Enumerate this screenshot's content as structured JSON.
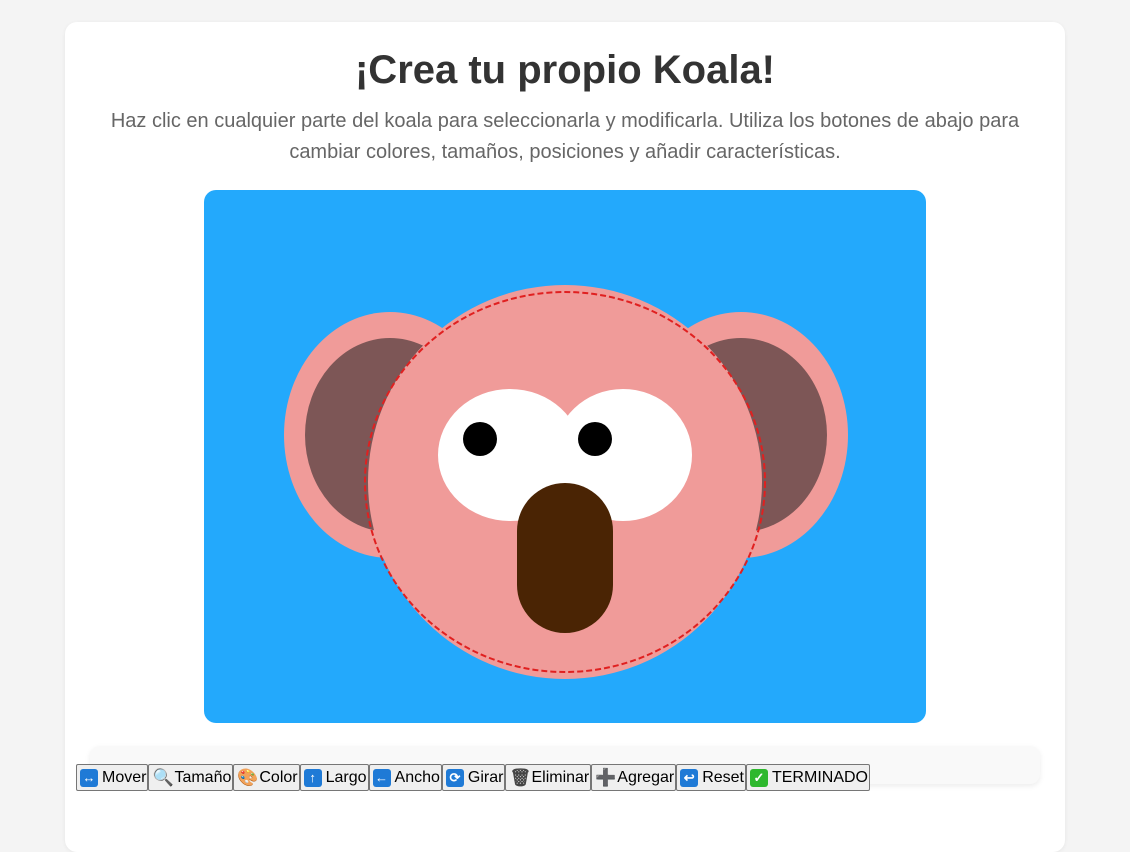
{
  "header": {
    "title": "¡Crea tu propio Koala!",
    "instructions": "Haz clic en cualquier parte del koala para seleccionarla y modificarla. Utiliza los botones de abajo para cambiar colores, tamaños, posiciones y añadir características."
  },
  "koala": {
    "background_color": "#23a9fc",
    "ear_outer_color": "#f09b99",
    "ear_inner_color": "#7d5656",
    "head_color": "#f09b99",
    "eye_white_color": "#ffffff",
    "pupil_color": "#000000",
    "nose_color": "#4a2404",
    "selection_outline_color": "#e02020",
    "selected_part": "head"
  },
  "toolbar": {
    "buttons": [
      {
        "name": "move-button",
        "icon": "left-right-arrow-icon",
        "glyph": "↔",
        "style": "blue",
        "label": "Mover"
      },
      {
        "name": "size-button",
        "icon": "magnifier-icon",
        "glyph": "🔍",
        "style": "plain",
        "label": "Tamaño"
      },
      {
        "name": "color-button",
        "icon": "palette-icon",
        "glyph": "🎨",
        "style": "plain",
        "label": "Color"
      },
      {
        "name": "length-button",
        "icon": "up-arrow-icon",
        "glyph": "↑",
        "style": "blue",
        "label": "Largo"
      },
      {
        "name": "width-button",
        "icon": "left-arrow-icon",
        "glyph": "←",
        "style": "blue",
        "label": "Ancho"
      },
      {
        "name": "rotate-button",
        "icon": "rotate-icon",
        "glyph": "⟳",
        "style": "blue",
        "label": "Girar"
      },
      {
        "name": "delete-button",
        "icon": "trash-icon",
        "glyph": "🗑",
        "style": "plain",
        "label": "Eliminar"
      },
      {
        "name": "add-button",
        "icon": "plus-icon",
        "glyph": "➕",
        "style": "plain",
        "label": "Agregar"
      },
      {
        "name": "reset-button",
        "icon": "return-arrow-icon",
        "glyph": "↩",
        "style": "blue",
        "label": "Reset"
      },
      {
        "name": "done-button",
        "icon": "check-mark-icon",
        "glyph": "✓",
        "style": "green",
        "label": "TERMINADO"
      }
    ]
  }
}
